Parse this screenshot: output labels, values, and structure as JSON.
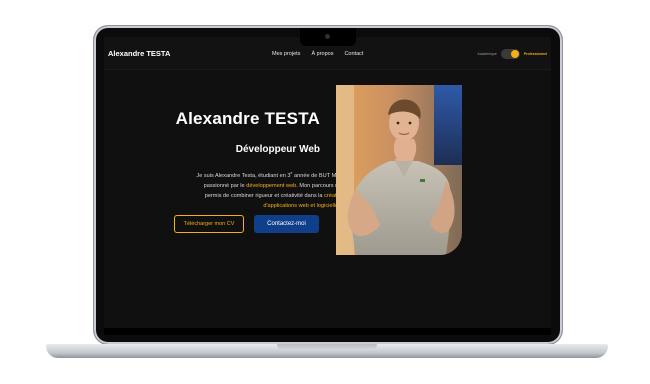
{
  "nav": {
    "brand": "Alexandre TESTA",
    "links": [
      "Mes projets",
      "À propos",
      "Contact"
    ],
    "mode_left": "Académique",
    "mode_right": "Professionnel"
  },
  "hero": {
    "name": "Alexandre TESTA",
    "role": "Développeur Web",
    "desc_1": "Je suis Alexandre Testa, étudiant en 3",
    "desc_sup": "e",
    "desc_2": " année de BUT MMI,",
    "desc_3": "passionné par le ",
    "desc_hl1": "développement web",
    "desc_4": ". Mon parcours m'a",
    "desc_5": "permis de combiner rigueur et créativité dans la ",
    "desc_hl2": "création",
    "desc_hl3": "d'applications web et logicielles",
    "desc_6": " .",
    "btn_cv": "Télécharger mon CV",
    "btn_contact": "Contactez-moi"
  },
  "icons": [
    "camera-icon",
    "toggle-icon"
  ],
  "colors": {
    "accent": "#f4b014",
    "primary_button": "#0f3f8a",
    "background": "#101010"
  }
}
